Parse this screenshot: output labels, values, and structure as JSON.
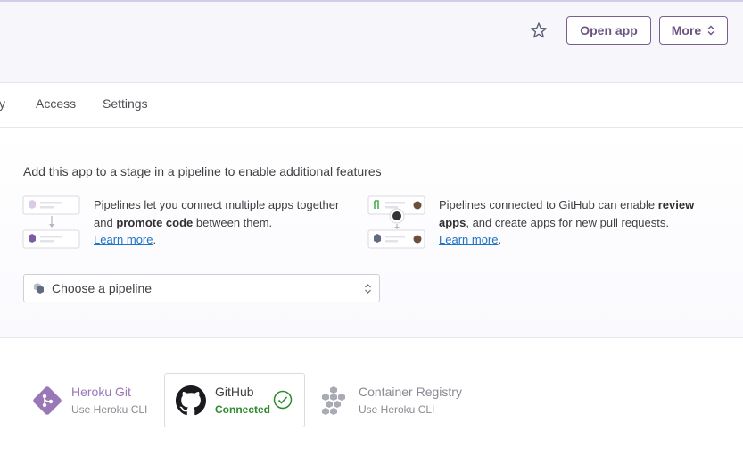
{
  "header": {
    "favorite_icon": "star-icon",
    "open_app_label": "Open app",
    "more_label": "More",
    "more_icon": "chevron-up-down-icon"
  },
  "tabs": [
    {
      "label": "cy"
    },
    {
      "label": "Access"
    },
    {
      "label": "Settings"
    }
  ],
  "pipeline": {
    "title": "Add this app to a stage in a pipeline to enable additional features",
    "left_feature": {
      "text_1": "Pipelines let you connect multiple apps together and ",
      "bold": "promote code",
      "text_2": " between them.",
      "link": "Learn more",
      "suffix": "."
    },
    "right_feature": {
      "text_1": "Pipelines connected to GitHub can enable ",
      "bold": "review apps",
      "text_2": ", and create apps for new pull requests.",
      "link": "Learn more",
      "suffix": "."
    },
    "select": {
      "value": "Choose a pipeline",
      "icon": "pipeline-icon"
    }
  },
  "deploy_methods": [
    {
      "name": "Heroku Git",
      "sub": "Use Heroku CLI",
      "icon": "heroku-git-icon"
    },
    {
      "name": "GitHub",
      "sub": "Connected",
      "icon": "github-icon",
      "selected": true
    },
    {
      "name": "Container Registry",
      "sub": "Use Heroku CLI",
      "icon": "container-registry-icon"
    }
  ],
  "colors": {
    "accent": "#79589f",
    "link": "#1f74c7",
    "connected": "#2d8a2d"
  }
}
